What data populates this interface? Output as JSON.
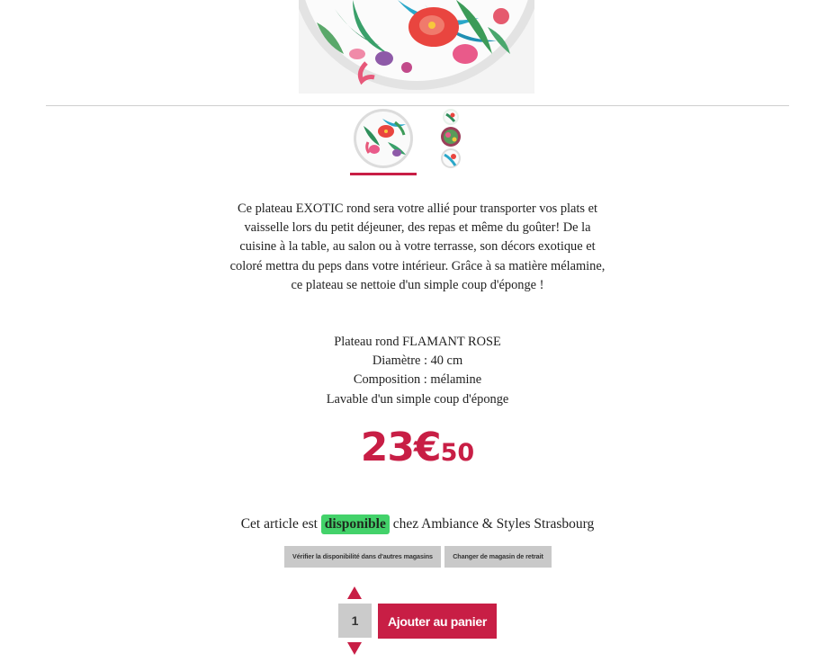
{
  "product": {
    "description": "Ce plateau EXOTIC rond sera votre allié pour transporter vos plats et vaisselle lors du petit déjeuner, des repas et même du goûter! De la cuisine à la table, au salon ou à votre terrasse, son décors exotique et coloré mettra du peps dans votre intérieur. Grâce à sa matière mélamine, ce plateau se nettoie d'un simple coup d'éponge !",
    "specs": [
      "Plateau rond FLAMANT ROSE",
      "Diamètre : 40 cm",
      "Composition : mélamine",
      "Lavable d'un simple coup d'éponge"
    ],
    "price_euros": "23€",
    "price_cents": "50"
  },
  "availability": {
    "prefix": "Cet article est",
    "status": "disponible",
    "suffix": "chez Ambiance & Styles Strasbourg"
  },
  "store_buttons": {
    "check_other": "Vérifier la disponibilité dans d'autres magasins",
    "change_store": "Changer de magasin de retrait"
  },
  "cart": {
    "quantity": "1",
    "add_label": "Ajouter au panier"
  },
  "colors": {
    "accent": "#c81e45",
    "available": "#43d26a"
  }
}
